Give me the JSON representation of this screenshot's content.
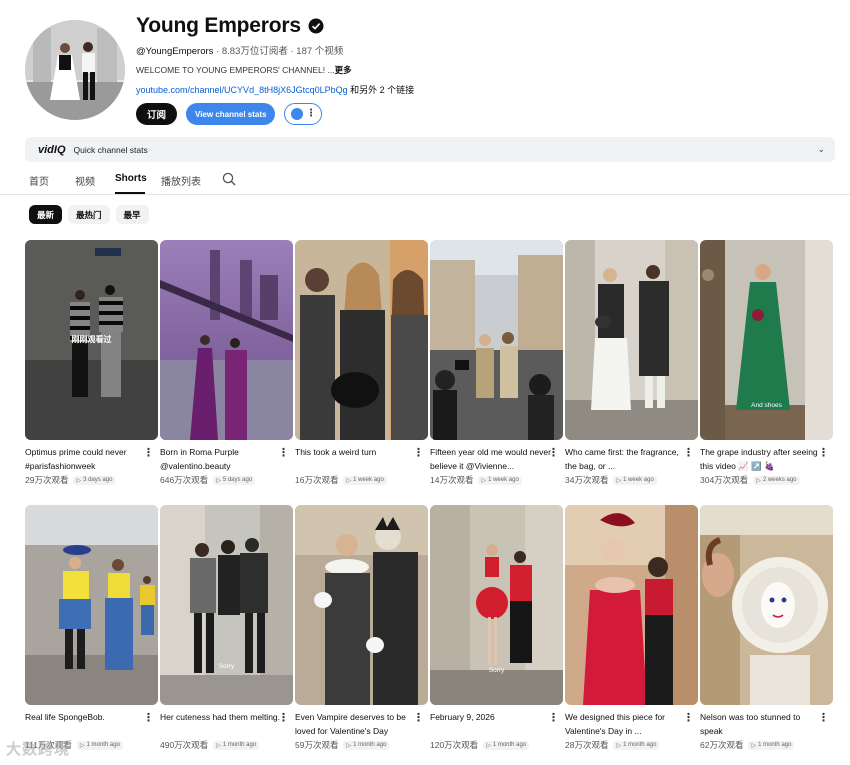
{
  "channel": {
    "name": "Young Emperors",
    "handle": "@YoungEmperors",
    "stats": "· 8.83万位订阅者 · 187 个视频",
    "description": "WELCOME TO YOUNG EMPERORS' CHANNEL! ...",
    "more_label": "更多",
    "link_url": "youtube.com/channel/UCYVd_8tH8jX6JGtcq0LPbQg",
    "link_extra": " 和另外 2 个链接",
    "subscribe_label": "订阅",
    "stats_button_label": "View channel stats"
  },
  "vidiq": {
    "logo": "vidIQ",
    "label": "Quick channel stats"
  },
  "tabs": [
    "首页",
    "视频",
    "Shorts",
    "播放列表"
  ],
  "active_tab": "Shorts",
  "filters": [
    "最新",
    "最热门",
    "最早"
  ],
  "active_filter": "最新",
  "shorts": [
    {
      "title": "Optimus prime could never #parisfashionweek",
      "views": "29万次观看",
      "age": "3 days ago",
      "badge": "刚刚观看过"
    },
    {
      "title": "Born in Roma Purple @valentino.beauty",
      "views": "646万次观看",
      "age": "5 days ago"
    },
    {
      "title": "This took a weird turn",
      "views": "16万次观看",
      "age": "1 week ago"
    },
    {
      "title": "Fifteen year old me would never believe it @Vivienne...",
      "views": "14万次观看",
      "age": "1 week ago"
    },
    {
      "title": "Who came first: the fragrance, the bag, or ...",
      "views": "34万次观看",
      "age": "1 week ago"
    },
    {
      "title": "The grape industry after seeing this video 📈 ↗️ 🍇",
      "views": "304万次观看",
      "age": "2 weeks ago",
      "overlay": "And shoes"
    },
    {
      "title": "Real life SpongeBob.",
      "views": "111万次观看",
      "age": "1 month ago"
    },
    {
      "title": "Her cuteness had them melting.",
      "views": "490万次观看",
      "age": "1 month ago",
      "overlay": "Sorry"
    },
    {
      "title": "Even Vampire deserves to be loved for Valentine's Day",
      "views": "59万次观看",
      "age": "1 month ago"
    },
    {
      "title": "February 9, 2026",
      "views": "120万次观看",
      "age": "1 month ago",
      "overlay": "Sorry"
    },
    {
      "title": "We designed this piece for Valentine's Day in ...",
      "views": "28万次观看",
      "age": "1 month ago"
    },
    {
      "title": "Nelson was too stunned to speak",
      "views": "62万次观看",
      "age": "1 month ago"
    }
  ],
  "watermark": "大数跨境",
  "colors": {
    "accent_blue": "#3d87ec",
    "link_blue": "#065fd4",
    "text": "#0f0f0f"
  }
}
